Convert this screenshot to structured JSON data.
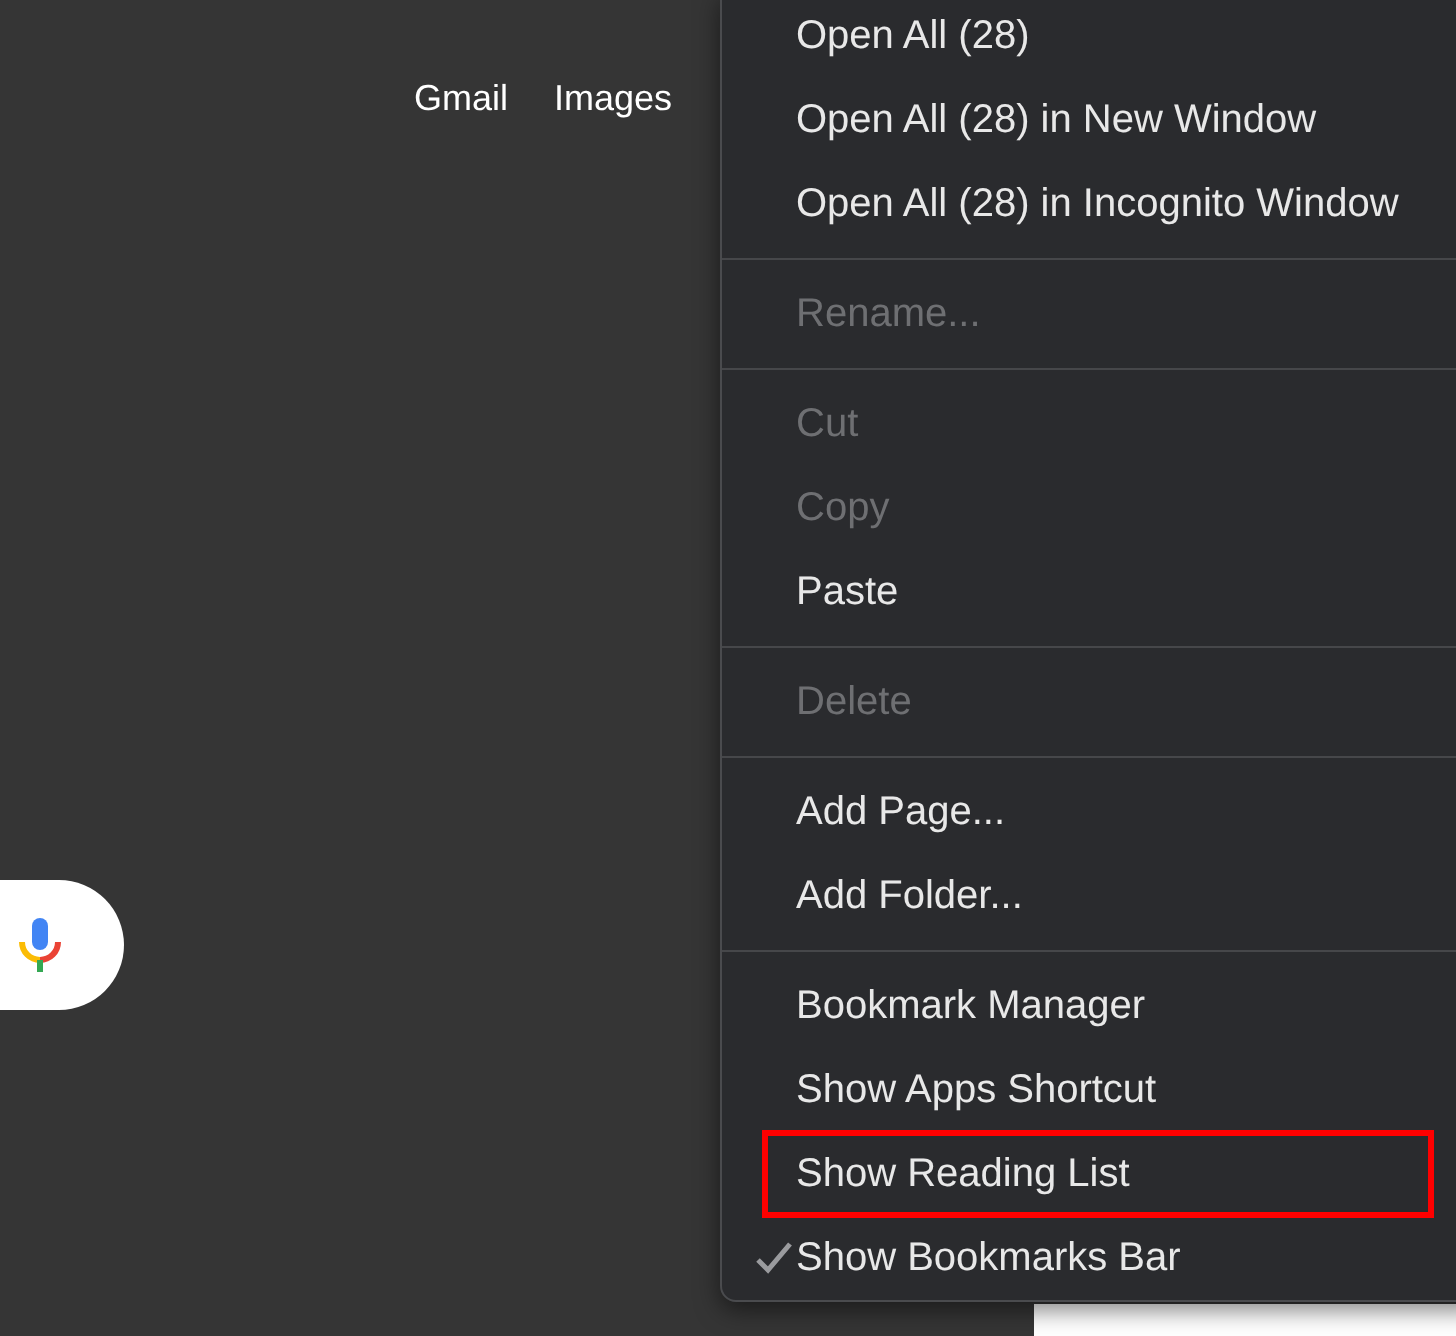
{
  "top_links": [
    {
      "label": "Gmail"
    },
    {
      "label": "Images"
    }
  ],
  "context_menu": {
    "groups": [
      {
        "items": [
          {
            "label": "Open All (28)",
            "disabled": false,
            "checked": false,
            "highlighted": false
          },
          {
            "label": "Open All (28) in New Window",
            "disabled": false,
            "checked": false,
            "highlighted": false
          },
          {
            "label": "Open All (28) in Incognito Window",
            "disabled": false,
            "checked": false,
            "highlighted": false
          }
        ]
      },
      {
        "items": [
          {
            "label": "Rename...",
            "disabled": true,
            "checked": false,
            "highlighted": false
          }
        ]
      },
      {
        "items": [
          {
            "label": "Cut",
            "disabled": true,
            "checked": false,
            "highlighted": false
          },
          {
            "label": "Copy",
            "disabled": true,
            "checked": false,
            "highlighted": false
          },
          {
            "label": "Paste",
            "disabled": false,
            "checked": false,
            "highlighted": false
          }
        ]
      },
      {
        "items": [
          {
            "label": "Delete",
            "disabled": true,
            "checked": false,
            "highlighted": false
          }
        ]
      },
      {
        "items": [
          {
            "label": "Add Page...",
            "disabled": false,
            "checked": false,
            "highlighted": false
          },
          {
            "label": "Add Folder...",
            "disabled": false,
            "checked": false,
            "highlighted": false
          }
        ]
      },
      {
        "items": [
          {
            "label": "Bookmark Manager",
            "disabled": false,
            "checked": false,
            "highlighted": false
          },
          {
            "label": "Show Apps Shortcut",
            "disabled": false,
            "checked": false,
            "highlighted": false
          },
          {
            "label": "Show Reading List",
            "disabled": false,
            "checked": false,
            "highlighted": true
          },
          {
            "label": "Show Bookmarks Bar",
            "disabled": false,
            "checked": true,
            "highlighted": false
          }
        ]
      }
    ]
  }
}
